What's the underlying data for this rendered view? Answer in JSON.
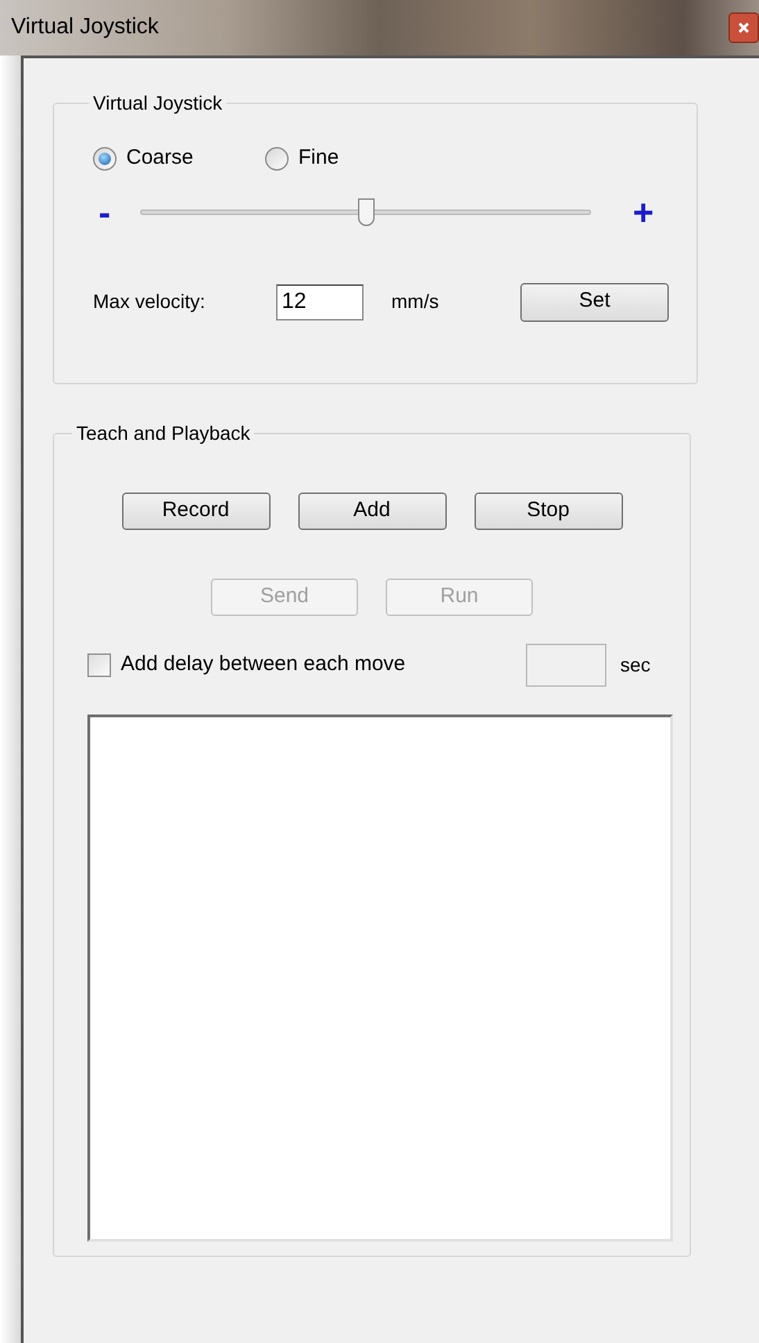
{
  "window": {
    "title": "Virtual Joystick"
  },
  "joystick": {
    "title": "Virtual Joystick",
    "modes": [
      {
        "label": "Coarse",
        "selected": true
      },
      {
        "label": "Fine",
        "selected": false
      }
    ],
    "minus": "-",
    "plus": "+",
    "speed": {
      "level": 0.5
    },
    "max_velocity": {
      "label": "Max velocity:",
      "value": "12",
      "unit": "mm/s"
    },
    "set_button": "Set"
  },
  "teach": {
    "title": "Teach and Playback",
    "button_rows": [
      [
        {
          "label": "Record",
          "disabled": false
        },
        {
          "label": "Add",
          "disabled": false
        },
        {
          "label": "Stop",
          "disabled": false
        }
      ],
      [
        {
          "label": "Send",
          "disabled": true
        },
        {
          "label": "Run",
          "disabled": true
        }
      ]
    ],
    "delay": {
      "label": "Add delay between each move",
      "checked": false,
      "field_disabled": true,
      "unit": "sec"
    }
  }
}
